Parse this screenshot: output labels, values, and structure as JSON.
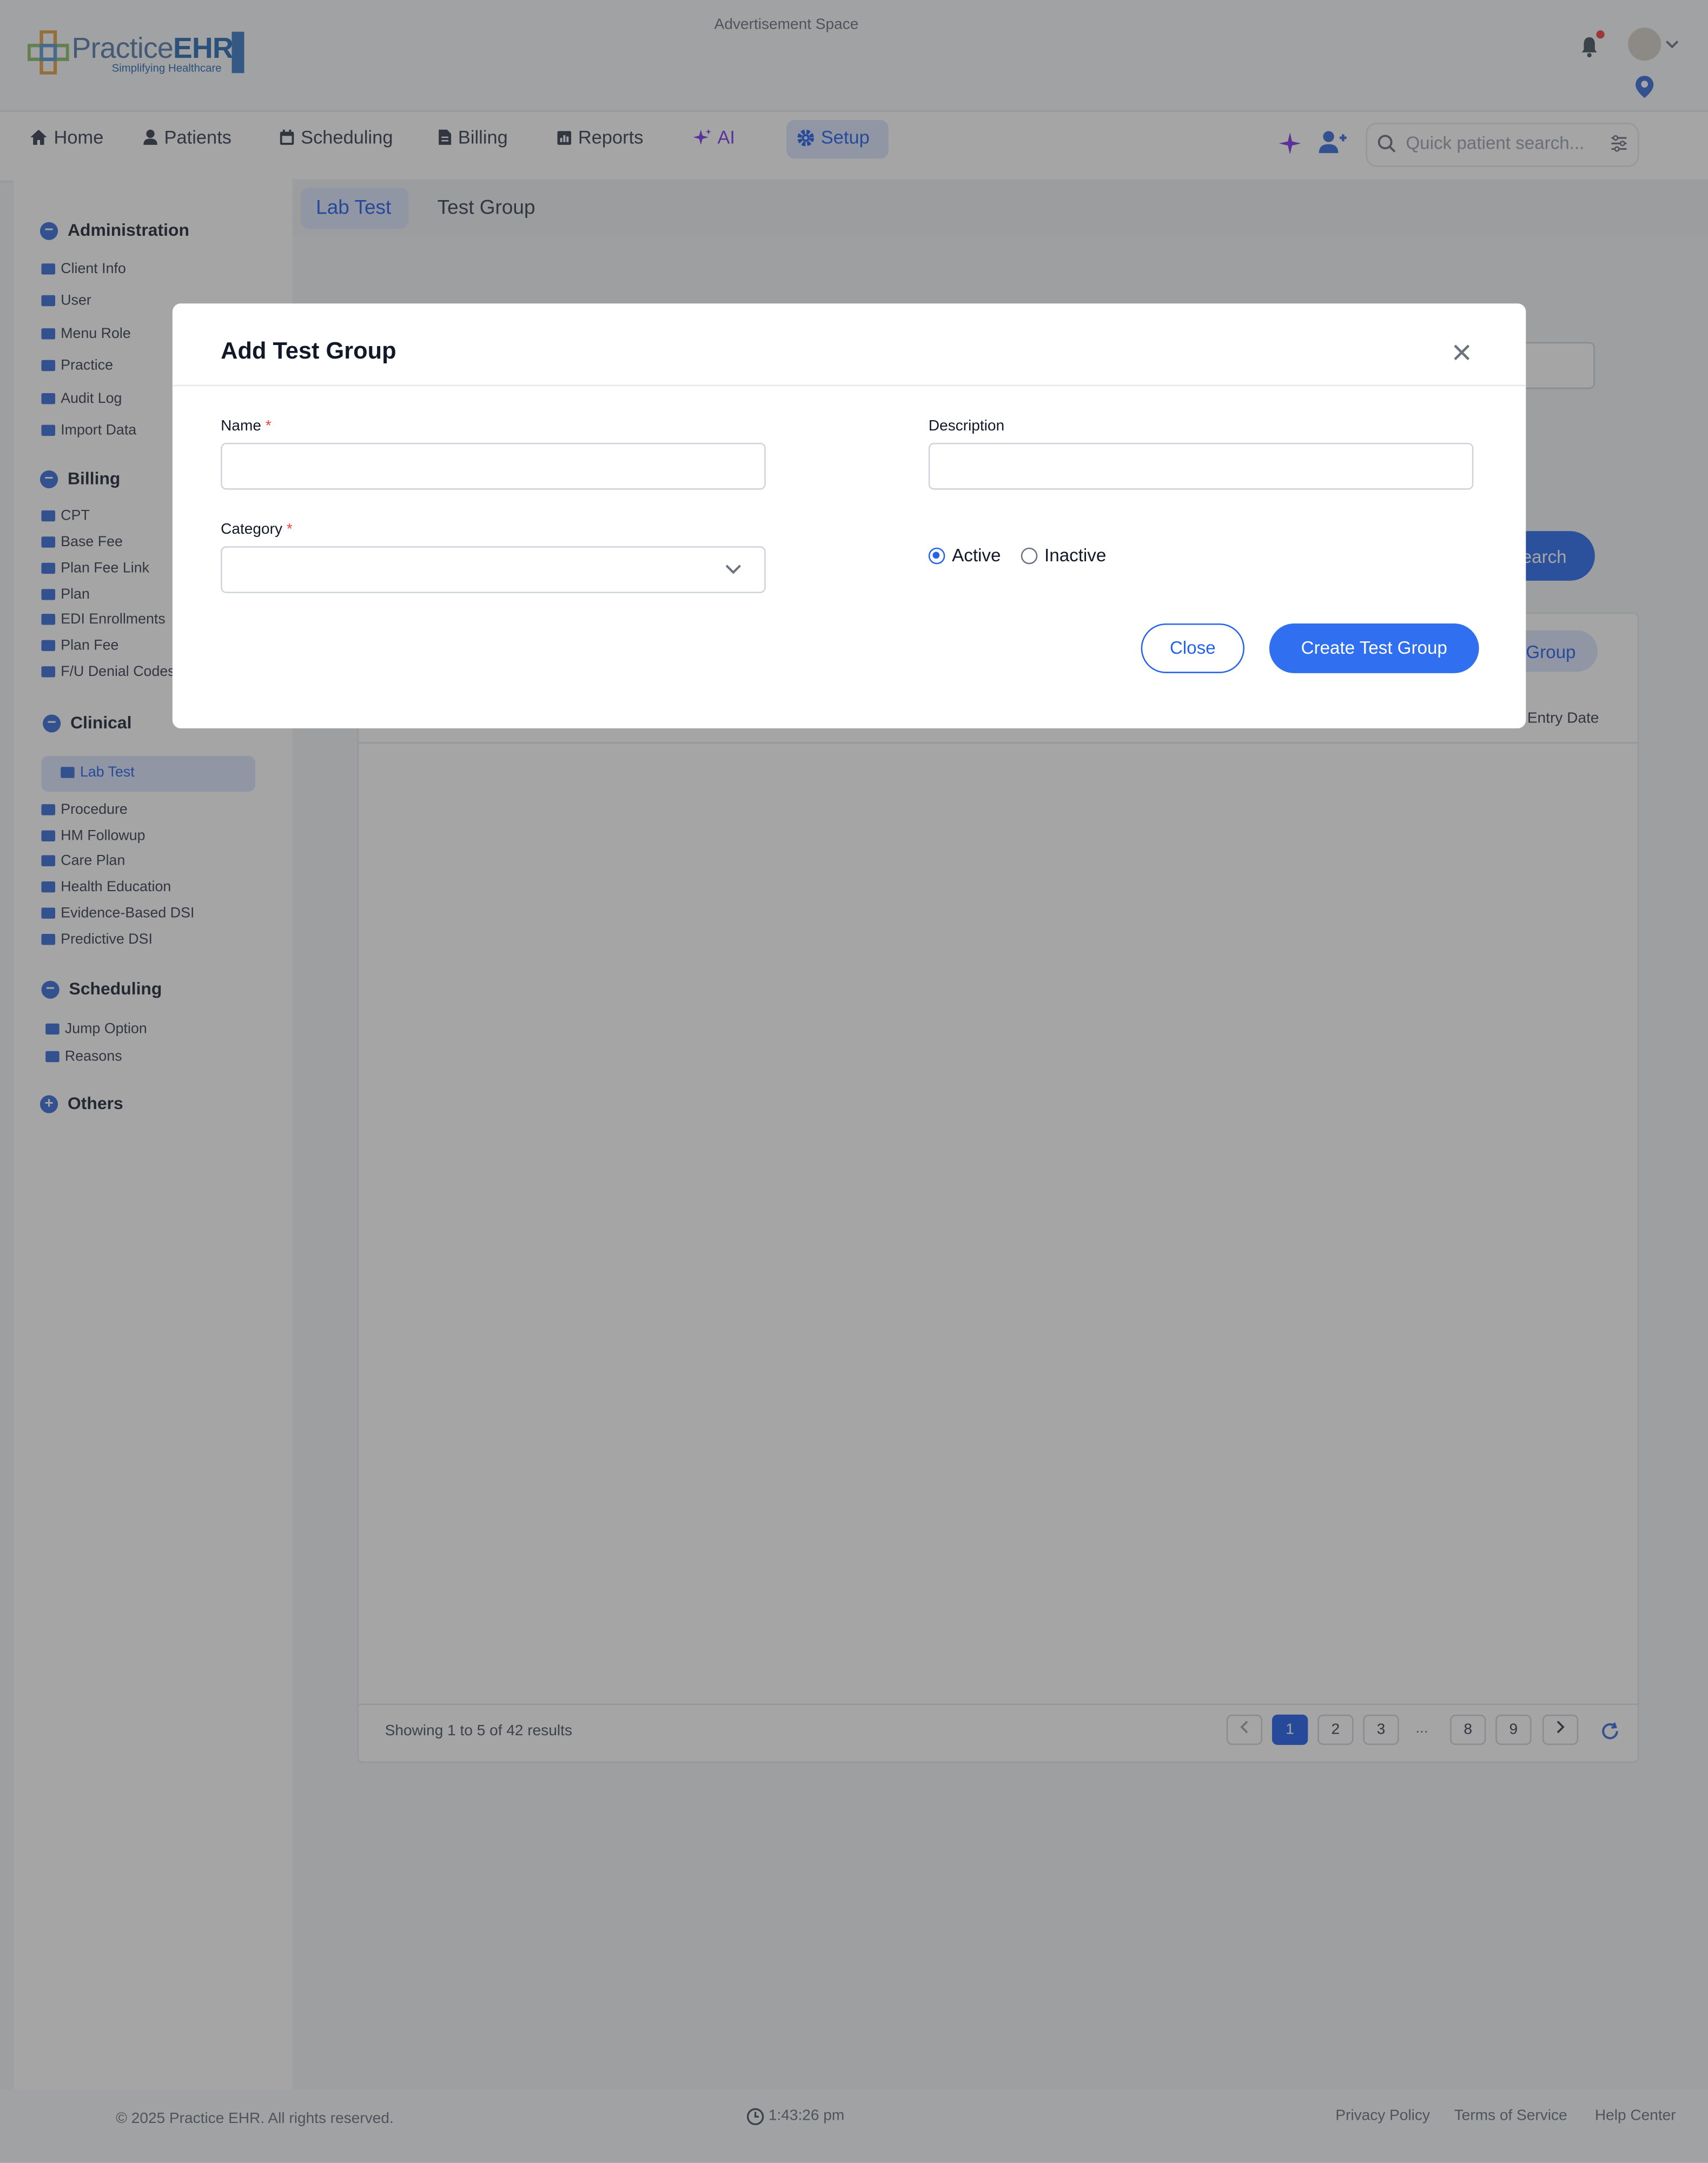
{
  "header": {
    "ad_text": "Advertisement Space",
    "logo_primary": "Practice",
    "logo_secondary": "EHR",
    "logo_tagline": "Simplifying Healthcare"
  },
  "nav": {
    "items": [
      {
        "label": "Home",
        "icon": "home-icon"
      },
      {
        "label": "Patients",
        "icon": "patients-icon"
      },
      {
        "label": "Scheduling",
        "icon": "calendar-icon"
      },
      {
        "label": "Billing",
        "icon": "billing-icon"
      },
      {
        "label": "Reports",
        "icon": "reports-icon"
      },
      {
        "label": "AI",
        "icon": "sparkle-icon"
      },
      {
        "label": "Setup",
        "icon": "gear-icon"
      }
    ],
    "search_placeholder": "Quick patient search..."
  },
  "sidebar": {
    "administration": {
      "title": "Administration",
      "items": [
        "Client Info",
        "User",
        "Menu Role",
        "Practice",
        "Audit Log",
        "Import Data"
      ]
    },
    "billing": {
      "title": "Billing",
      "items": [
        "CPT",
        "Base Fee",
        "Plan Fee Link",
        "Plan",
        "EDI Enrollments",
        "Plan Fee",
        "F/U Denial Codes"
      ]
    },
    "clinical": {
      "title": "Clinical",
      "items": [
        "Lab Test",
        "Procedure",
        "HM Followup",
        "Care Plan",
        "Health Education",
        "Evidence-Based DSI",
        "Predictive DSI"
      ]
    },
    "scheduling": {
      "title": "Scheduling",
      "items": [
        "Jump Option",
        "Reasons"
      ]
    },
    "others": {
      "title": "Others"
    }
  },
  "tabs": {
    "lab_test": "Lab Test",
    "test_group": "Test Group"
  },
  "background": {
    "search_button": "earch",
    "add_group_button": "Group",
    "entry_date_header": "Entry Date",
    "results_text": "Showing 1 to 5 of 42 results",
    "pages": [
      "1",
      "2",
      "3",
      "...",
      "8",
      "9"
    ]
  },
  "modal": {
    "title": "Add Test Group",
    "name_label": "Name",
    "name_value": "",
    "description_label": "Description",
    "description_value": "",
    "category_label": "Category",
    "category_value": "",
    "required_mark": "*",
    "status_options": [
      "Active",
      "Inactive"
    ],
    "status_selected": "Active",
    "close_button": "Close",
    "create_button": "Create Test Group"
  },
  "footer": {
    "copyright": "© 2025 Practice EHR. All rights reserved.",
    "time": "1:43:26 pm",
    "links": [
      "Privacy Policy",
      "Terms of Service",
      "Help Center"
    ]
  }
}
